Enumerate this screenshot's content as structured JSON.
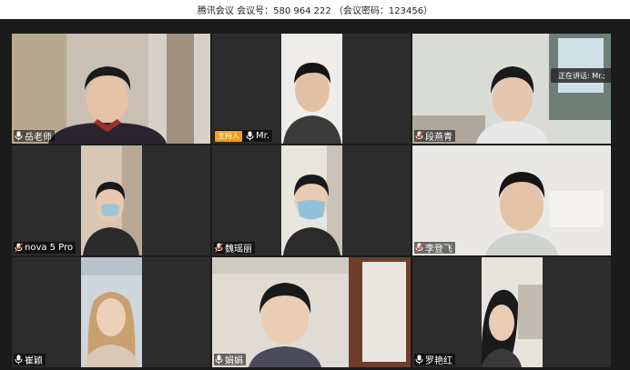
{
  "window": {
    "title": "腾讯会议 会议号：580 964 222 （会议密码：123456）"
  },
  "speaking_indicator": "正在讲话: Mr.;",
  "host_badge": "主持人",
  "participants": [
    {
      "name": "岳老师",
      "icon": "mic-icon"
    },
    {
      "name": "Mr.",
      "icon": "mic-icon",
      "host": true
    },
    {
      "name": "段燕青",
      "icon": "mic-muted-icon"
    },
    {
      "name": "nova 5 Pro",
      "icon": "mic-muted-icon"
    },
    {
      "name": "魏瑶丽",
      "icon": "mic-muted-icon"
    },
    {
      "name": "李登飞",
      "icon": "mic-muted-icon"
    },
    {
      "name": "崔颖",
      "icon": "mic-icon"
    },
    {
      "name": "娟娟",
      "icon": "mic-icon"
    },
    {
      "name": "罗艳红",
      "icon": "mic-icon"
    }
  ],
  "colors": {
    "stage_bg": "#1b1b1b",
    "host_badge": "#f39c12",
    "muted_mic": "#e74c3c"
  }
}
